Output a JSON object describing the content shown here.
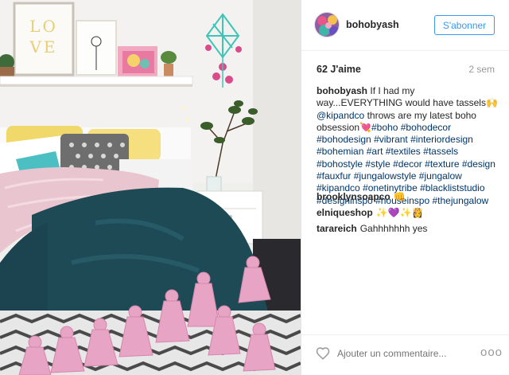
{
  "post": {
    "username": "bohobyash",
    "follow_label": "S'abonner",
    "likes": "62 J'aime",
    "time_ago": "2 sem",
    "caption": {
      "username": "bohobyash",
      "text_1": "If I had my way...EVERYTHING would have tassels",
      "emoji_hands": "🙌",
      "mention": "@kipandco",
      "text_2": "throws are my latest boho obsession",
      "emoji_heart": "💘",
      "hashtags": [
        "#boho",
        "#bohodecor",
        "#bohodesign",
        "#vibrant",
        "#interiordesign",
        "#bohemian",
        "#art",
        "#textiles",
        "#tassels",
        "#bohostyle",
        "#style",
        "#decor",
        "#texture",
        "#design",
        "#fauxfur",
        "#jungalowstyle",
        "#jungalow",
        "#kipandco",
        "#onetinytribe",
        "#blackliststudio",
        "#designinspo",
        "#houseinspo",
        "#thejungalow"
      ]
    },
    "comments": [
      {
        "user": "brooklynsoapco",
        "text": "👊"
      },
      {
        "user": "elniqueshop",
        "text": "✨💜✨👸"
      },
      {
        "user": "tarareich",
        "text": "Gahhhhhhh yes"
      }
    ],
    "add_comment_placeholder": "Ajouter un commentaire...",
    "more_label": "ooo",
    "icons": {
      "like": "heart-outline-icon",
      "more": "more-options-icon"
    },
    "photo": {
      "wall_art_text": "LOVE",
      "accent_colors": {
        "wall": "#efefed",
        "throw": "#1e4a55",
        "tassels": "#e8a4c4",
        "fur": "#e9c5cf",
        "hanger": "#3fc4b8"
      }
    }
  }
}
